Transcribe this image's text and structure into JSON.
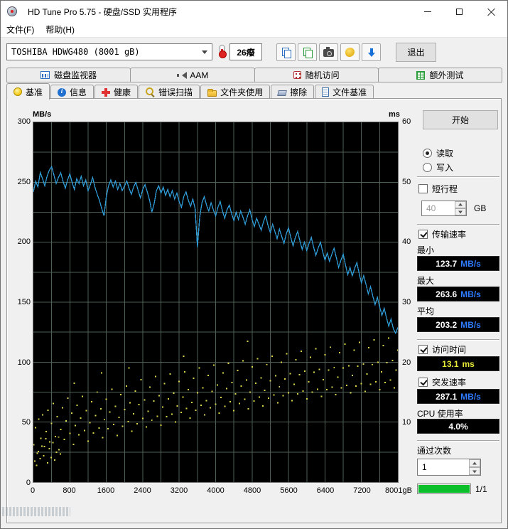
{
  "window": {
    "title": "HD Tune Pro 5.75 - 硬盘/SSD 实用程序"
  },
  "menu": {
    "file": "文件(F)",
    "help": "帮助(H)"
  },
  "toolbar": {
    "drive_selector": "TOSHIBA HDWG480 (8001 gB)",
    "temperature": "26癈",
    "exit_button": "退出",
    "icon_buttons": [
      "copy-text",
      "copy-image",
      "screenshot-camera",
      "color-splash",
      "save-results"
    ]
  },
  "tabs": {
    "row1": [
      {
        "label": "磁盘监视器",
        "icon": "disk-monitor"
      },
      {
        "label": "AAM",
        "icon": "speaker"
      },
      {
        "label": "随机访问",
        "icon": "dice"
      },
      {
        "label": "额外测试",
        "icon": "test-grid"
      }
    ],
    "row2": [
      {
        "label": "基准",
        "icon": "bulb",
        "active": true
      },
      {
        "label": "信息",
        "icon": "info"
      },
      {
        "label": "健康",
        "icon": "health-cross"
      },
      {
        "label": "错误扫描",
        "icon": "magnifier"
      },
      {
        "label": "文件夹使用",
        "icon": "folder"
      },
      {
        "label": "擦除",
        "icon": "eraser"
      },
      {
        "label": "文件基准",
        "icon": "file"
      }
    ]
  },
  "panel": {
    "start_button": "开始",
    "read_label": "读取",
    "write_label": "写入",
    "short_stroke_label": "短行程",
    "short_stroke_value": "40",
    "short_stroke_unit": "GB",
    "transfer_label": "传输速率",
    "min_label": "最小",
    "min_value": "123.7",
    "max_label": "最大",
    "max_value": "263.6",
    "avg_label": "平均",
    "avg_value": "203.2",
    "speed_unit": "MB/s",
    "access_label": "访问时间",
    "access_value": "13.1",
    "access_unit": "ms",
    "burst_label": "突发速率",
    "burst_value": "287.1",
    "cpu_label": "CPU 使用率",
    "cpu_value": "4.0%",
    "pass_label": "通过次数",
    "pass_value": "1",
    "progress_text": "1/1",
    "progress_percent": 100,
    "progress_color": "#0bbf2b"
  },
  "chart_data": {
    "type": "line",
    "x_max": 8000,
    "x_axis": {
      "ticks": [
        0,
        800,
        1600,
        2400,
        3200,
        4000,
        4800,
        5600,
        6400,
        7200
      ],
      "end_value": 8000,
      "end_label": "8001gB"
    },
    "y_left": {
      "label": "MB/s",
      "max": 300,
      "ticks": [
        300,
        250,
        200,
        150,
        100,
        50,
        0
      ]
    },
    "y_right": {
      "label": "ms",
      "max": 60,
      "ticks": [
        60,
        50,
        40,
        30,
        20,
        10
      ]
    },
    "grid": {
      "x_step": 400,
      "y_step": 25
    },
    "colors": {
      "plot_bg": "#000000",
      "grid": "#4f6157",
      "line": "#2e9bd6",
      "access": "#d8d44a"
    },
    "transfer_rate": {
      "name": "传输速率",
      "x_step": 50,
      "values": [
        242,
        251,
        246,
        258,
        253,
        247,
        255,
        260,
        263,
        256,
        249,
        254,
        258,
        251,
        245,
        252,
        257,
        250,
        244,
        253,
        249,
        255,
        247,
        252,
        243,
        248,
        254,
        246,
        240,
        235,
        228,
        222,
        238,
        247,
        252,
        246,
        251,
        244,
        249,
        243,
        247,
        251,
        245,
        240,
        246,
        250,
        243,
        237,
        244,
        248,
        242,
        235,
        225,
        232,
        243,
        247,
        241,
        246,
        239,
        244,
        238,
        243,
        236,
        241,
        234,
        229,
        238,
        242,
        235,
        230,
        236,
        228,
        196,
        221,
        233,
        238,
        231,
        226,
        233,
        227,
        222,
        229,
        234,
        226,
        220,
        227,
        231,
        224,
        218,
        225,
        219,
        226,
        221,
        215,
        222,
        227,
        219,
        213,
        220,
        215,
        210,
        217,
        222,
        214,
        208,
        215,
        209,
        203,
        211,
        205,
        199,
        207,
        212,
        204,
        197,
        204,
        209,
        201,
        194,
        200,
        193,
        199,
        204,
        196,
        189,
        195,
        200,
        192,
        185,
        191,
        184,
        190,
        195,
        187,
        179,
        185,
        190,
        181,
        173,
        179,
        172,
        178,
        183,
        174,
        166,
        172,
        165,
        157,
        163,
        155,
        148,
        154,
        146,
        139,
        145,
        137,
        130,
        136,
        128,
        124,
        129
      ]
    },
    "access_time": {
      "name": "访问时间",
      "points": [
        [
          30,
          3.5
        ],
        [
          70,
          2.8
        ],
        [
          110,
          5.1
        ],
        [
          150,
          3.9
        ],
        [
          190,
          6.0
        ],
        [
          230,
          4.4
        ],
        [
          270,
          7.2
        ],
        [
          310,
          3.2
        ],
        [
          350,
          5.6
        ],
        [
          390,
          4.1
        ],
        [
          430,
          6.6
        ],
        [
          470,
          3.7
        ],
        [
          510,
          5.0
        ],
        [
          550,
          7.5
        ],
        [
          590,
          4.7
        ],
        [
          10,
          6.2
        ],
        [
          50,
          9.1
        ],
        [
          85,
          4.8
        ],
        [
          120,
          10.5
        ],
        [
          160,
          7.3
        ],
        [
          200,
          11.2
        ],
        [
          240,
          5.9
        ],
        [
          280,
          8.4
        ],
        [
          320,
          12.0
        ],
        [
          360,
          6.7
        ],
        [
          400,
          9.8
        ],
        [
          440,
          13.1
        ],
        [
          480,
          7.6
        ],
        [
          520,
          10.9
        ],
        [
          560,
          5.4
        ],
        [
          600,
          8.8
        ],
        [
          640,
          12.4
        ],
        [
          680,
          7.1
        ],
        [
          720,
          10.2
        ],
        [
          760,
          14.0
        ],
        [
          800,
          8.1
        ],
        [
          840,
          11.5
        ],
        [
          880,
          6.3
        ],
        [
          920,
          9.4
        ],
        [
          960,
          12.8
        ],
        [
          1000,
          7.9
        ],
        [
          1040,
          10.7
        ],
        [
          1080,
          14.3
        ],
        [
          1120,
          8.6
        ],
        [
          1160,
          11.9
        ],
        [
          1200,
          6.8
        ],
        [
          1240,
          9.9
        ],
        [
          1280,
          13.4
        ],
        [
          1320,
          8.2
        ],
        [
          1360,
          11.1
        ],
        [
          1400,
          15.0
        ],
        [
          1440,
          9.0
        ],
        [
          1480,
          12.2
        ],
        [
          1520,
          7.4
        ],
        [
          1560,
          10.4
        ],
        [
          1600,
          13.8
        ],
        [
          1640,
          8.9
        ],
        [
          1680,
          11.7
        ],
        [
          1720,
          15.5
        ],
        [
          1760,
          9.6
        ],
        [
          1800,
          12.6
        ],
        [
          1840,
          7.8
        ],
        [
          1880,
          10.8
        ],
        [
          1920,
          14.6
        ],
        [
          1960,
          9.3
        ],
        [
          2000,
          12.1
        ],
        [
          2040,
          16.0
        ],
        [
          2080,
          10.1
        ],
        [
          2120,
          13.2
        ],
        [
          2160,
          8.5
        ],
        [
          2200,
          11.4
        ],
        [
          2240,
          15.2
        ],
        [
          2280,
          9.7
        ],
        [
          2320,
          12.9
        ],
        [
          2360,
          17.1
        ],
        [
          2400,
          10.6
        ],
        [
          2440,
          13.7
        ],
        [
          2480,
          9.2
        ],
        [
          2520,
          11.8
        ],
        [
          2560,
          15.8
        ],
        [
          2600,
          10.3
        ],
        [
          2640,
          13.5
        ],
        [
          2680,
          17.6
        ],
        [
          2720,
          11.0
        ],
        [
          2760,
          14.4
        ],
        [
          2800,
          9.5
        ],
        [
          2840,
          12.5
        ],
        [
          2880,
          16.4
        ],
        [
          2920,
          10.9
        ],
        [
          2960,
          13.9
        ],
        [
          3000,
          18.0
        ],
        [
          3040,
          11.3
        ],
        [
          3080,
          14.8
        ],
        [
          3120,
          10.0
        ],
        [
          3160,
          12.7
        ],
        [
          3200,
          16.8
        ],
        [
          3240,
          11.6
        ],
        [
          3280,
          14.2
        ],
        [
          3320,
          18.4
        ],
        [
          3360,
          12.3
        ],
        [
          3400,
          15.4
        ],
        [
          3440,
          10.7
        ],
        [
          3480,
          13.3
        ],
        [
          3520,
          17.3
        ],
        [
          3560,
          12.0
        ],
        [
          3600,
          14.9
        ],
        [
          3640,
          19.0
        ],
        [
          3680,
          12.8
        ],
        [
          3720,
          15.7
        ],
        [
          3760,
          11.2
        ],
        [
          3800,
          13.6
        ],
        [
          3840,
          17.8
        ],
        [
          3880,
          12.4
        ],
        [
          3920,
          15.1
        ],
        [
          3960,
          19.5
        ],
        [
          4000,
          13.0
        ],
        [
          4040,
          16.2
        ],
        [
          4080,
          11.5
        ],
        [
          4120,
          14.1
        ],
        [
          4160,
          18.2
        ],
        [
          4200,
          12.6
        ],
        [
          4240,
          15.6
        ],
        [
          4280,
          19.8
        ],
        [
          4320,
          13.4
        ],
        [
          4360,
          16.6
        ],
        [
          4400,
          11.9
        ],
        [
          4440,
          14.7
        ],
        [
          4480,
          18.6
        ],
        [
          4520,
          13.1
        ],
        [
          4560,
          16.0
        ],
        [
          4600,
          20.2
        ],
        [
          4640,
          13.8
        ],
        [
          4680,
          17.0
        ],
        [
          4720,
          12.2
        ],
        [
          4760,
          15.0
        ],
        [
          4800,
          19.2
        ],
        [
          4840,
          13.5
        ],
        [
          4880,
          16.5
        ],
        [
          4920,
          20.6
        ],
        [
          4960,
          14.2
        ],
        [
          5000,
          17.4
        ],
        [
          5040,
          12.7
        ],
        [
          5080,
          15.3
        ],
        [
          5120,
          19.6
        ],
        [
          5160,
          14.0
        ],
        [
          5200,
          16.9
        ],
        [
          5240,
          21.0
        ],
        [
          5280,
          14.5
        ],
        [
          5320,
          17.7
        ],
        [
          5360,
          13.2
        ],
        [
          5400,
          15.9
        ],
        [
          5440,
          20.0
        ],
        [
          5480,
          14.4
        ],
        [
          5520,
          17.2
        ],
        [
          5560,
          21.4
        ],
        [
          5600,
          14.9
        ],
        [
          5640,
          18.1
        ],
        [
          5680,
          13.6
        ],
        [
          5720,
          16.3
        ],
        [
          5760,
          20.4
        ],
        [
          5800,
          14.7
        ],
        [
          5840,
          17.9
        ],
        [
          5880,
          21.8
        ],
        [
          5920,
          15.2
        ],
        [
          5960,
          18.5
        ],
        [
          6000,
          13.9
        ],
        [
          6040,
          16.7
        ],
        [
          6080,
          20.8
        ],
        [
          6120,
          15.0
        ],
        [
          6160,
          18.3
        ],
        [
          6200,
          22.2
        ],
        [
          6240,
          15.5
        ],
        [
          6280,
          18.8
        ],
        [
          6320,
          14.3
        ],
        [
          6360,
          17.1
        ],
        [
          6400,
          21.2
        ],
        [
          6440,
          15.4
        ],
        [
          6480,
          18.7
        ],
        [
          6520,
          22.5
        ],
        [
          6560,
          15.8
        ],
        [
          6600,
          19.1
        ],
        [
          6640,
          14.6
        ],
        [
          6680,
          17.5
        ],
        [
          6720,
          21.6
        ],
        [
          6760,
          15.7
        ],
        [
          6800,
          19.0
        ],
        [
          6840,
          23.0
        ],
        [
          6880,
          16.1
        ],
        [
          6920,
          19.4
        ],
        [
          6960,
          14.9
        ],
        [
          7000,
          17.8
        ],
        [
          7040,
          22.0
        ],
        [
          7080,
          16.0
        ],
        [
          7120,
          19.3
        ],
        [
          7160,
          23.3
        ],
        [
          7200,
          16.4
        ],
        [
          7240,
          19.7
        ],
        [
          7280,
          15.1
        ],
        [
          7320,
          18.0
        ],
        [
          7360,
          22.4
        ],
        [
          7400,
          16.3
        ],
        [
          7440,
          19.6
        ],
        [
          7480,
          23.7
        ],
        [
          7520,
          16.7
        ],
        [
          7560,
          20.0
        ],
        [
          7600,
          15.4
        ],
        [
          7640,
          18.4
        ],
        [
          7680,
          22.8
        ],
        [
          7720,
          16.6
        ],
        [
          7760,
          19.9
        ],
        [
          7800,
          24.0
        ],
        [
          7840,
          17.0
        ],
        [
          7880,
          20.3
        ],
        [
          7920,
          15.7
        ],
        [
          7960,
          18.7
        ],
        [
          8000,
          22.0
        ],
        [
          900,
          16.5
        ],
        [
          1500,
          18.2
        ],
        [
          2100,
          19.0
        ],
        [
          3300,
          21.0
        ],
        [
          4700,
          23.5
        ]
      ]
    }
  }
}
